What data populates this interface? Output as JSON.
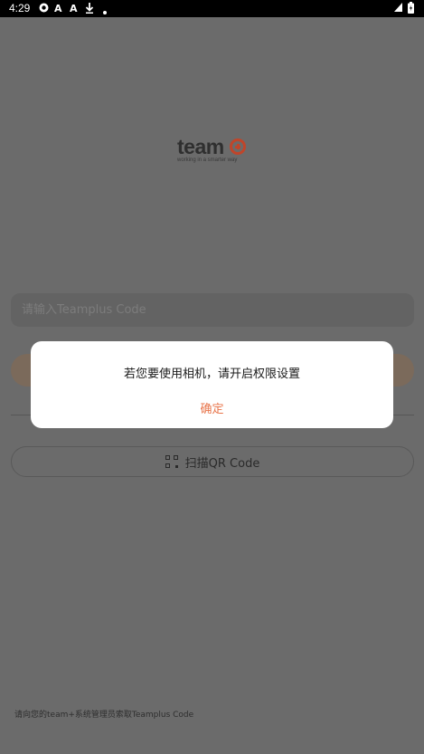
{
  "status_bar": {
    "time": "4:29",
    "left_icons": [
      "o-icon",
      "a-icon",
      "a-icon",
      "download-icon",
      "dot-icon"
    ],
    "right_icons": [
      "signal-icon",
      "battery-icon"
    ]
  },
  "logo": {
    "word": "team",
    "tagline": "working in a smarter way"
  },
  "login": {
    "code_placeholder": "请输入Teamplus Code",
    "qr_button_label": "扫描QR Code"
  },
  "footer": {
    "hint": "请向您的team+系统管理员索取Teamplus Code"
  },
  "dialog": {
    "message": "若您要使用相机，请开启权限设置",
    "confirm_label": "确定"
  },
  "colors": {
    "accent": "#e8744a",
    "logo_red": "#c0452a",
    "scrim_background": "#6b6b6b"
  }
}
